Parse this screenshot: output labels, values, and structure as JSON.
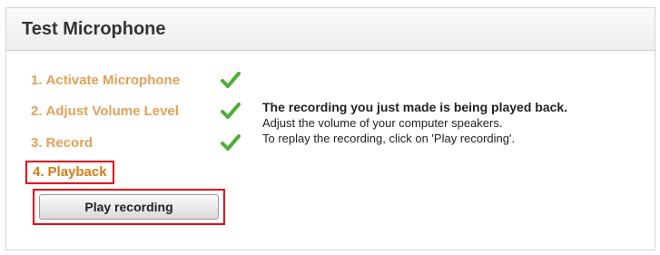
{
  "panel": {
    "title": "Test Microphone"
  },
  "steps": [
    {
      "number": "1.",
      "label": "Activate Microphone",
      "done": true
    },
    {
      "number": "2.",
      "label": "Adjust Volume Level",
      "done": true
    },
    {
      "number": "3.",
      "label": "Record",
      "done": true
    },
    {
      "number": "4.",
      "label": "Playback",
      "done": false,
      "active": true
    }
  ],
  "message": {
    "title": "The recording you just made is being played back.",
    "line1": "Adjust the volume of your computer speakers.",
    "line2": "To replay the recording, click on 'Play recording'."
  },
  "actions": {
    "play_label": "Play recording"
  },
  "colors": {
    "step_text": "#e0a15a",
    "active_step_text": "#d67b12",
    "highlight": "#e60012",
    "check": "#4caf32"
  },
  "icons": {
    "step_done": "checkmark-icon"
  }
}
